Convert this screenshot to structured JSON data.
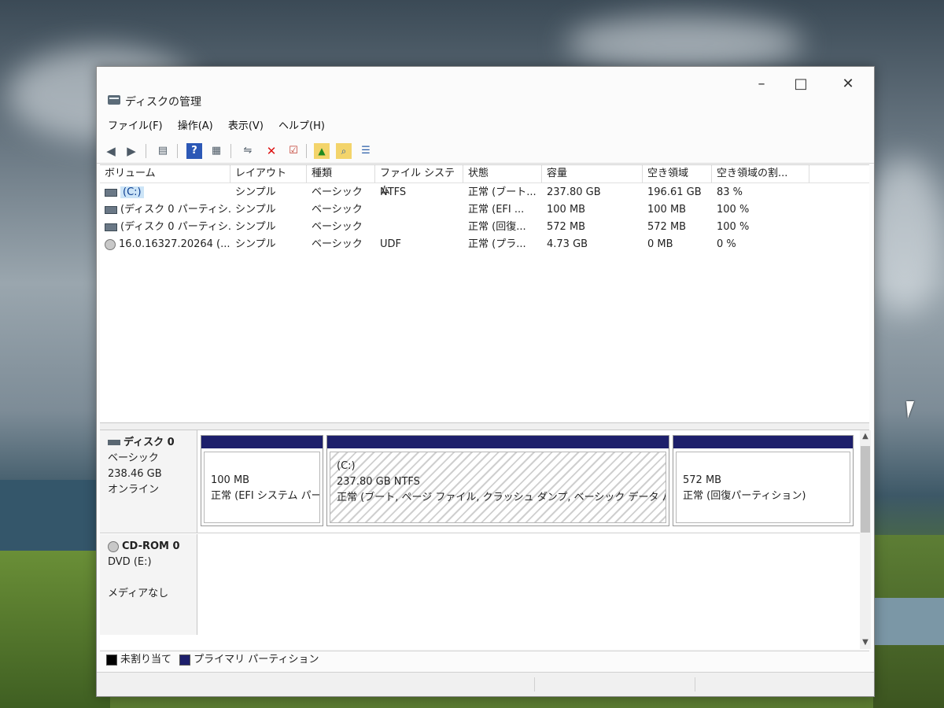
{
  "window": {
    "title": "ディスクの管理",
    "controls": {
      "minimize": "–",
      "maximize": "□",
      "close": "✕"
    }
  },
  "menu": [
    "ファイル(F)",
    "操作(A)",
    "表示(V)",
    "ヘルプ(H)"
  ],
  "toolbar_icons": [
    "back-icon",
    "forward-icon",
    "properties-icon",
    "help-icon",
    "view-icon",
    "connect-icon",
    "delete-icon",
    "check-icon",
    "up-icon",
    "search-icon",
    "list-icon"
  ],
  "list": {
    "headers": [
      "ボリューム",
      "レイアウト",
      "種類",
      "ファイル システム",
      "状態",
      "容量",
      "空き領域",
      "空き領域の割..."
    ],
    "rows": [
      [
        "(C:)",
        "シンプル",
        "ベーシック",
        "NTFS",
        "正常 (ブート...",
        "237.80 GB",
        "196.61 GB",
        "83 %"
      ],
      [
        "(ディスク 0 パーティシ...",
        "シンプル",
        "ベーシック",
        "",
        "正常 (EFI ...",
        "100 MB",
        "100 MB",
        "100 %"
      ],
      [
        "(ディスク 0 パーティシ...",
        "シンプル",
        "ベーシック",
        "",
        "正常 (回復...",
        "572 MB",
        "572 MB",
        "100 %"
      ],
      [
        "16.0.16327.20264 (...",
        "シンプル",
        "ベーシック",
        "UDF",
        "正常 (プラ...",
        "4.73 GB",
        "0 MB",
        "0 %"
      ]
    ]
  },
  "disks": {
    "disk0": {
      "name": "ディスク 0",
      "type": "ベーシック",
      "size": "238.46 GB",
      "status": "オンライン",
      "partitions": [
        {
          "line1": "100 MB",
          "line2": "正常 (EFI システム パー"
        },
        {
          "title": "(C:)",
          "line1": "237.80 GB NTFS",
          "line2": "正常 (ブート, ページ ファイル, クラッシュ ダンプ, ベーシック データ パーテ"
        },
        {
          "line1": "572 MB",
          "line2": "正常 (回復パーティション)"
        }
      ]
    },
    "cdrom0": {
      "name": "CD-ROM 0",
      "type": "DVD (E:)",
      "status": "メディアなし"
    }
  },
  "legend": {
    "unallocated": "未割り当て",
    "primary": "プライマリ パーティション",
    "unallocated_color": "#000000",
    "primary_color": "#1d1f6b"
  }
}
